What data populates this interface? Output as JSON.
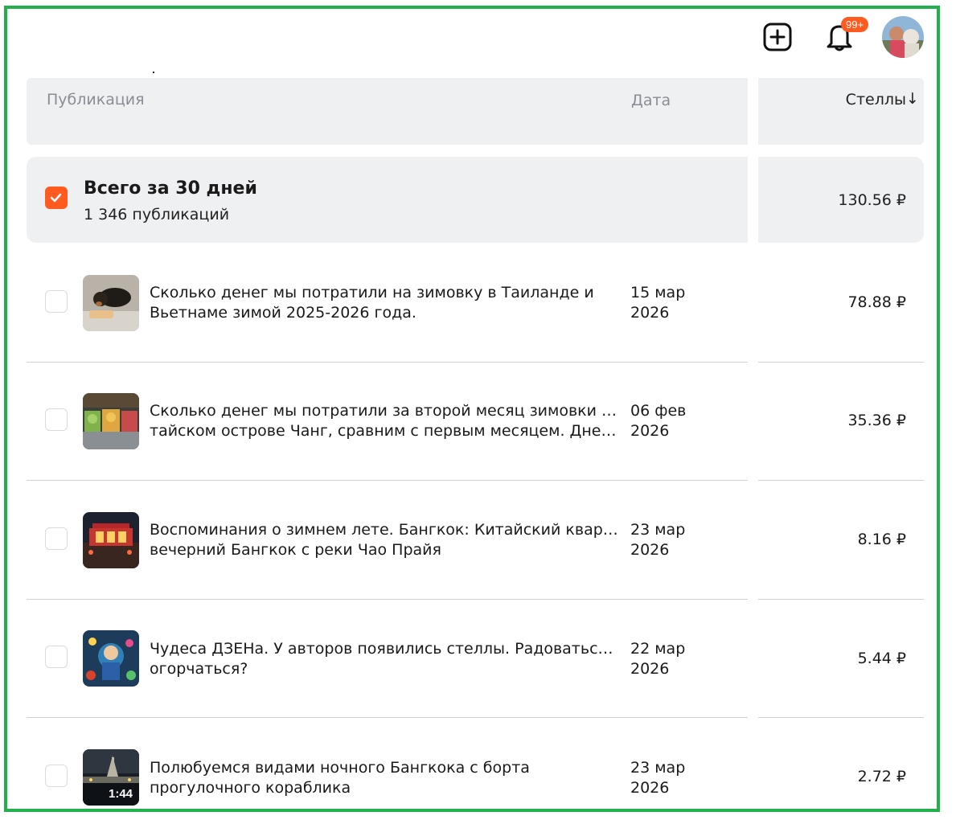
{
  "topbar": {
    "create_icon": "plus-square-icon",
    "bell_icon": "bell-icon",
    "notifications_badge": "99+"
  },
  "table": {
    "col_publication": "Публикация",
    "col_date": "Дата",
    "col_stells": "Стеллы",
    "sort_icon": "↓"
  },
  "total": {
    "title": "Всего за 30 дней",
    "subtitle": "1 346 публикаций",
    "value": "130.56 ₽"
  },
  "rows": [
    {
      "title_line1": "Сколько денег мы потратили на зимовку в Таиланде и",
      "title_line2": "Вьетнаме зимой 2025-2026 года.",
      "date_line1": "15 мар",
      "date_line2": "2026",
      "value": "78.88 ₽"
    },
    {
      "title_line1": "Сколько денег мы потратили за второй месяц зимовки на",
      "title_line2": "тайском острове Чанг, сравним с первым месяцем. Дневни...",
      "date_line1": "06 фев",
      "date_line2": "2026",
      "value": "35.36 ₽"
    },
    {
      "title_line1": "Воспоминания о зимнем лете. Бангкок: Китайский квартал и",
      "title_line2": "вечерний Бангкок с реки Чао Прайя",
      "date_line1": "23 мар",
      "date_line2": "2026",
      "value": "8.16 ₽"
    },
    {
      "title_line1": "Чудеса ДЗЕНа. У авторов появились стеллы. Радоваться или",
      "title_line2": "огорчаться?",
      "date_line1": "22 мар",
      "date_line2": "2026",
      "value": "5.44 ₽"
    },
    {
      "title_line1": "Полюбуемся видами ночного Бангкока с борта",
      "title_line2": "прогулочного кораблика",
      "date_line1": "23 мар",
      "date_line2": "2026",
      "value": "2.72 ₽",
      "duration": "1:44"
    }
  ],
  "colors": {
    "accent": "#ff5a1f",
    "frame": "#22b04a",
    "header_bg": "#eff0f2"
  }
}
